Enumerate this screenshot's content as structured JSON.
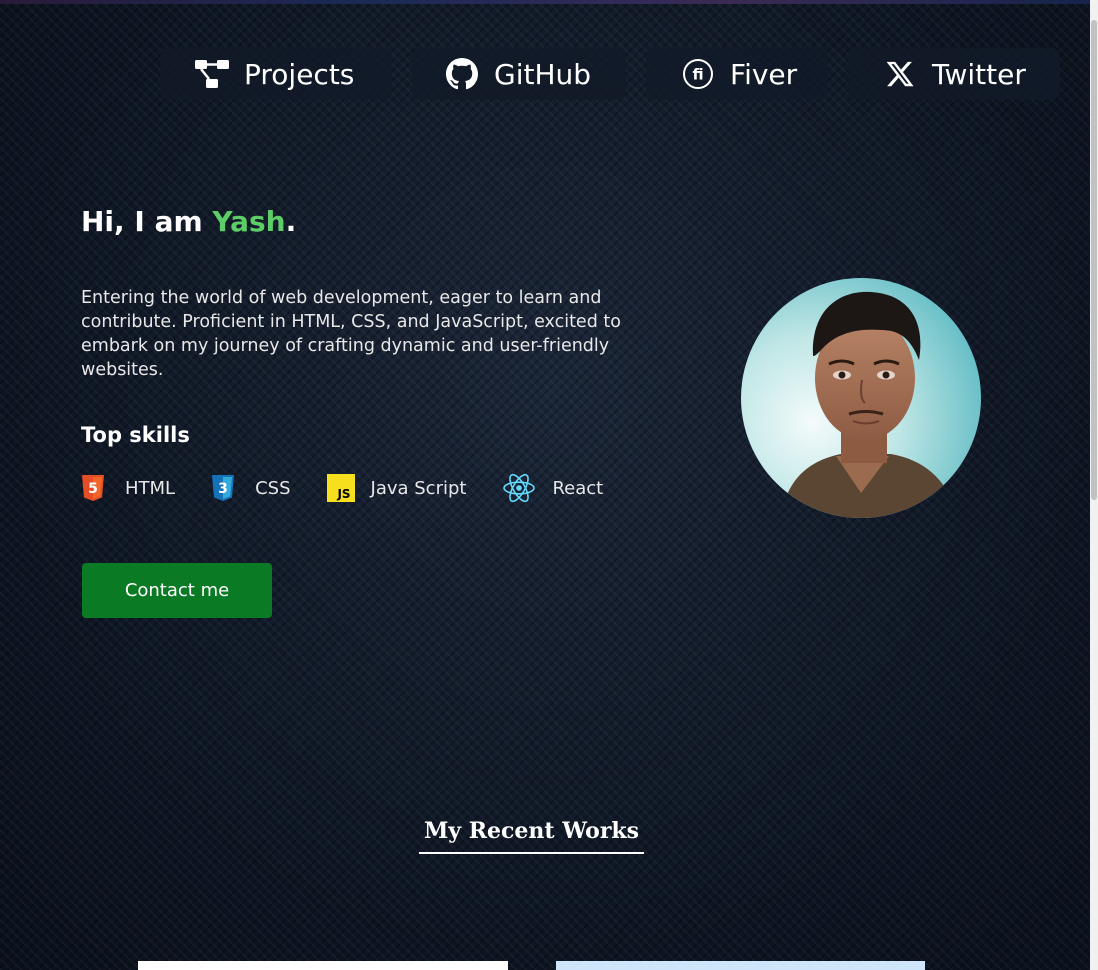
{
  "nav": {
    "items": [
      {
        "label": "Projects",
        "icon": "projects-icon"
      },
      {
        "label": "GitHub",
        "icon": "github-icon"
      },
      {
        "label": "Fiver",
        "icon": "fiverr-icon"
      },
      {
        "label": "Twitter",
        "icon": "x-icon"
      }
    ]
  },
  "hero": {
    "greeting_prefix": "Hi, I am ",
    "name": "Yash",
    "greeting_suffix": ".",
    "bio": "Entering the world of web development, eager to learn and contribute. Proficient in HTML, CSS, and JavaScript, excited to embark on my journey of crafting dynamic and user-friendly websites.",
    "skills_title": "Top skills",
    "skills": [
      {
        "label": "HTML",
        "icon": "html5-icon"
      },
      {
        "label": "CSS",
        "icon": "css3-icon"
      },
      {
        "label": "Java Script",
        "icon": "javascript-icon"
      },
      {
        "label": "React",
        "icon": "react-icon"
      }
    ],
    "contact_label": "Contact me"
  },
  "works": {
    "title": "My Recent Works"
  },
  "colors": {
    "accent_green": "#5ccd67",
    "button_green": "#0b7a24",
    "background": "#0f1827"
  }
}
